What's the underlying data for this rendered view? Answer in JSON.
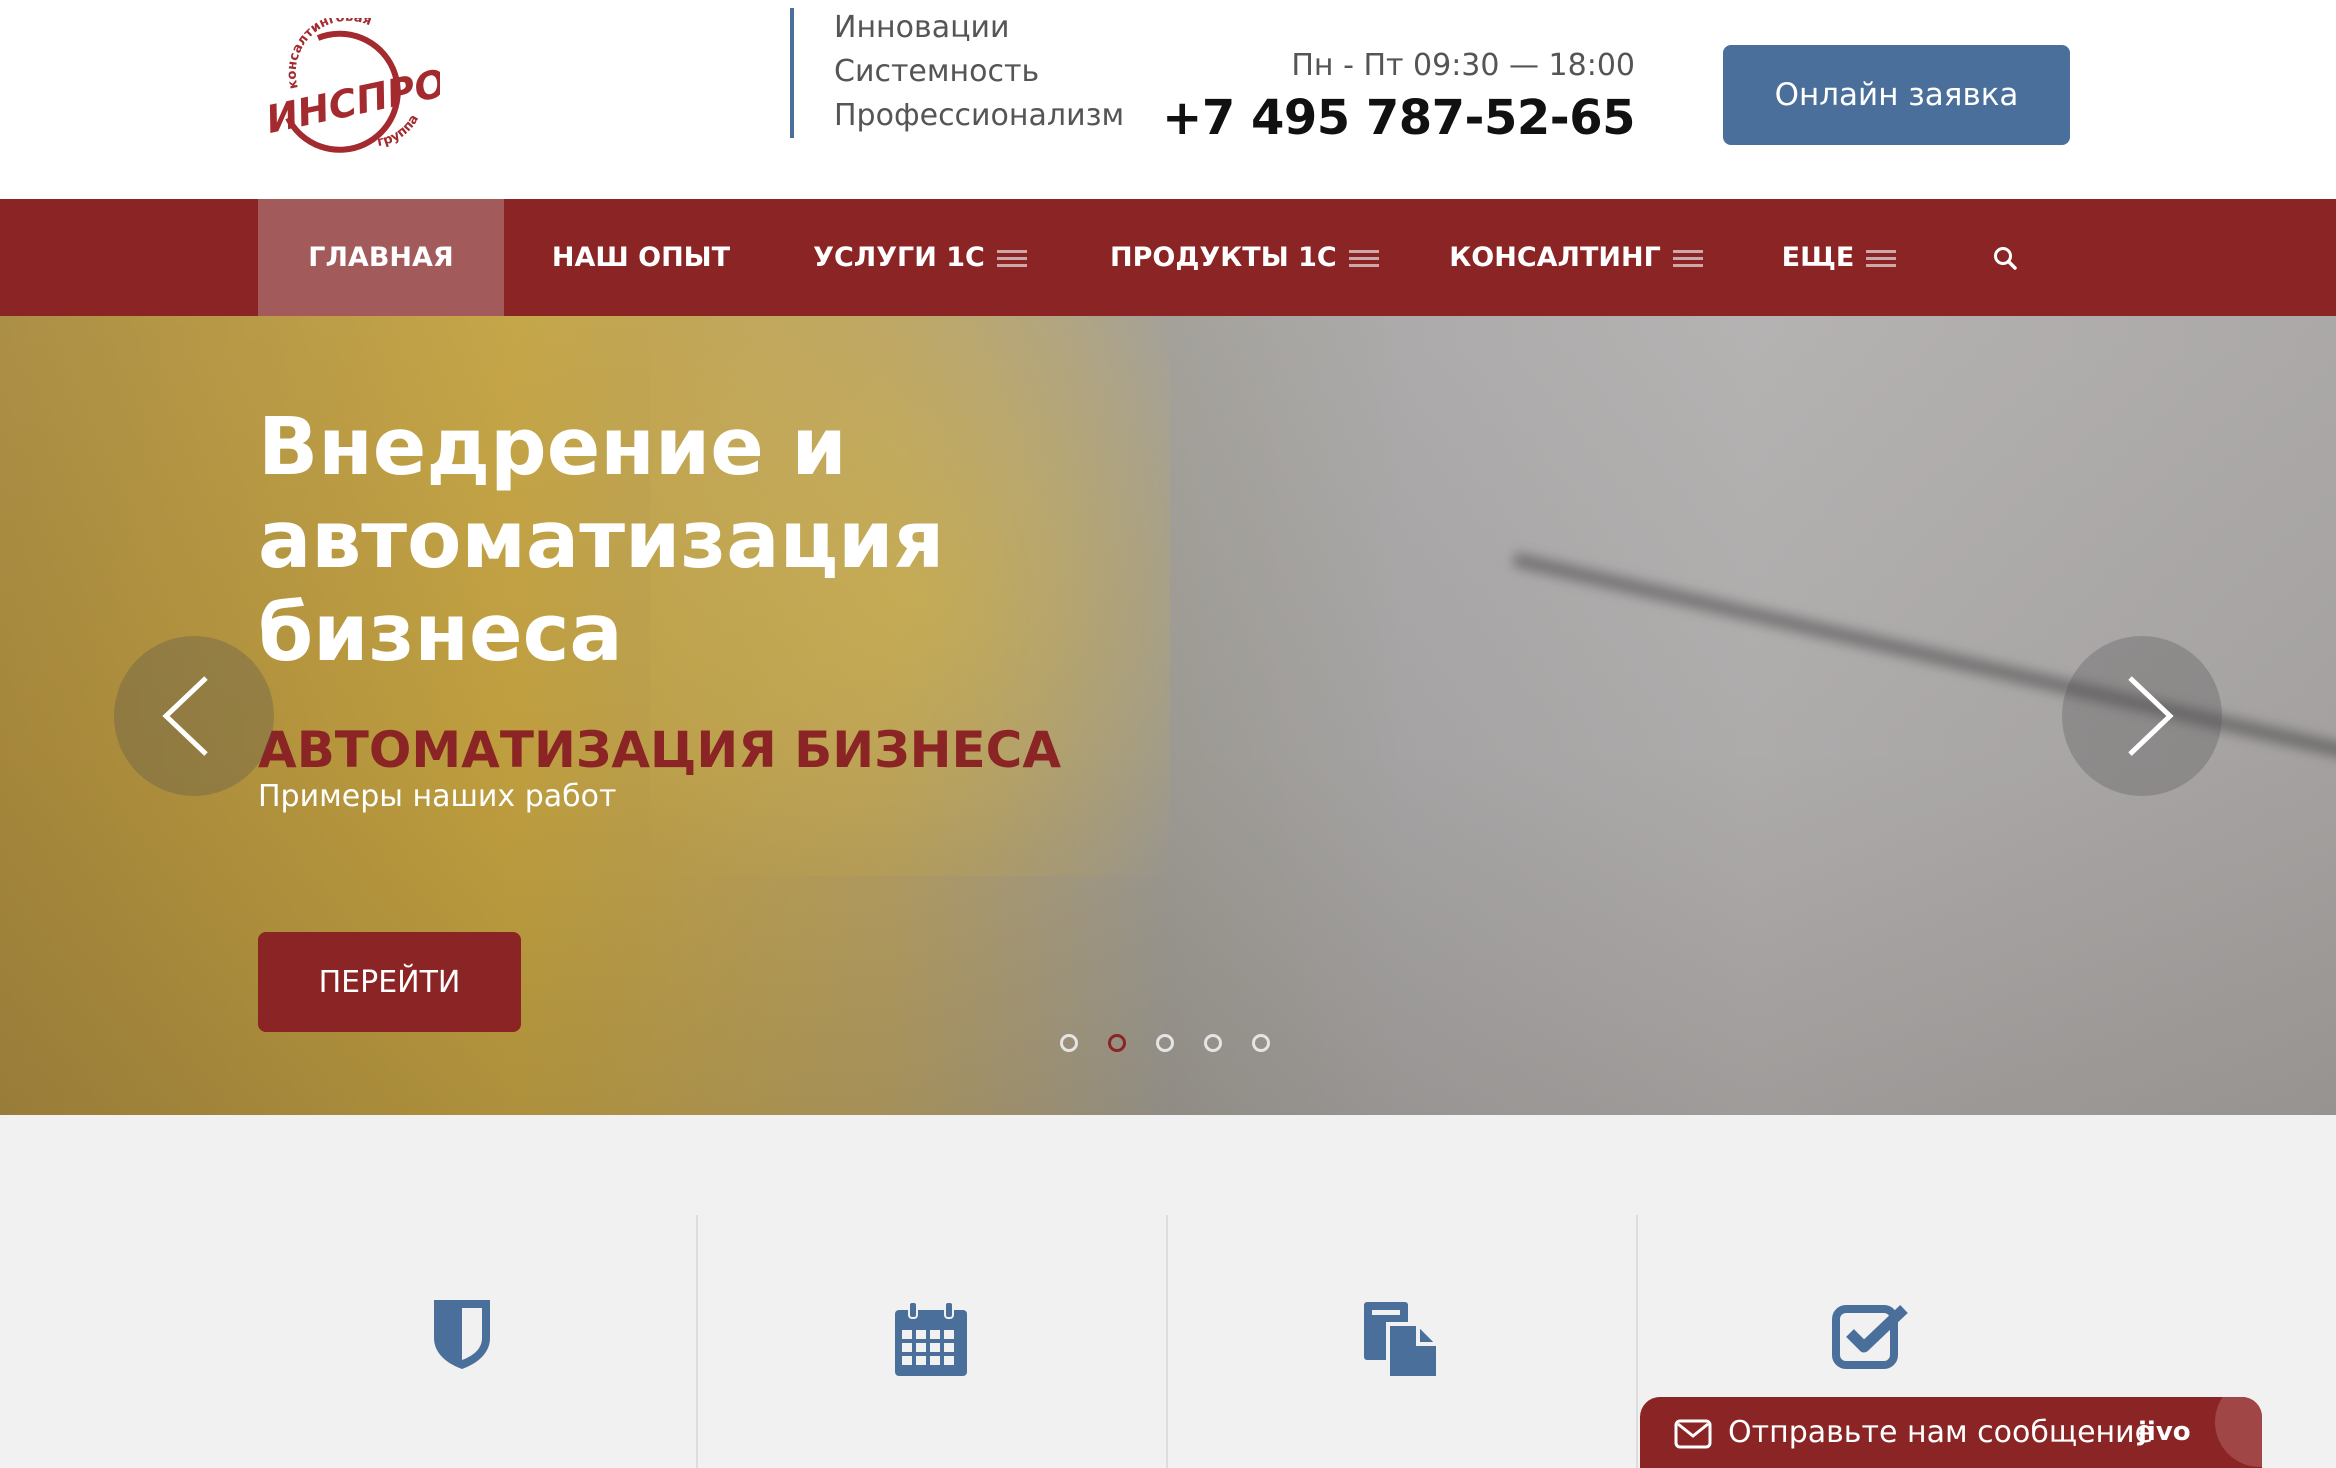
{
  "header": {
    "logo": {
      "main_text": "ИНСПРО",
      "arc_top": "консалтинговая",
      "arc_bottom": "группа",
      "color": "#a32a2e"
    },
    "tagline": [
      "Инновации",
      "Системность",
      "Профессионализм"
    ],
    "hours": "Пн - Пт 09:30 — 18:00",
    "phone": "+7 495 787-52-65",
    "cta_label": "Онлайн заявка"
  },
  "nav": {
    "items": [
      {
        "label": "ГЛАВНАЯ",
        "active": true
      },
      {
        "label": "НАШ ОПЫТ"
      },
      {
        "label": "УСЛУГИ 1С",
        "has_menu": true
      },
      {
        "label": "ПРОДУКТЫ 1С",
        "has_menu": true
      },
      {
        "label": "КОНСАЛТИНГ",
        "has_menu": true
      },
      {
        "label": "ЕЩЕ",
        "has_menu": true
      }
    ],
    "search_icon": "search-icon"
  },
  "hero": {
    "title": "Внедрение и автоматизация бизнеса",
    "subtitle": "АВТОМАТИЗАЦИЯ БИЗНЕСА",
    "subtitle2": "Примеры наших работ",
    "button_label": "ПЕРЕЙТИ",
    "slides_count": 5,
    "active_slide": 2
  },
  "features": {
    "icons": [
      "shield-icon",
      "calendar-icon",
      "documents-icon",
      "checkbox-icon"
    ]
  },
  "chat": {
    "label": "Отправьте нам сообщение",
    "brand": "jivo"
  },
  "colors": {
    "brand_red": "#8b2424",
    "brand_blue": "#4a6f9b"
  }
}
